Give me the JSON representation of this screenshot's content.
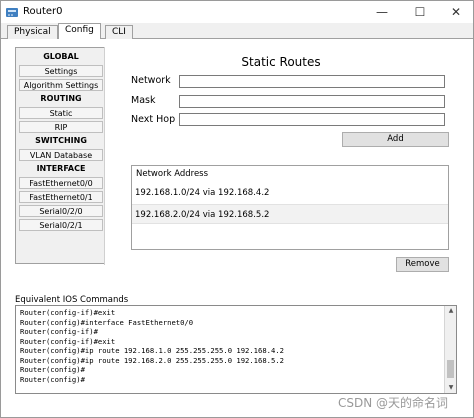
{
  "window": {
    "title": "Router0",
    "controls": {
      "minimize": "—",
      "maximize": "☐",
      "close": "✕"
    }
  },
  "tabs": [
    {
      "label": "Physical"
    },
    {
      "label": "Config"
    },
    {
      "label": "CLI"
    }
  ],
  "nav": {
    "global": "GLOBAL",
    "settings": "Settings",
    "algorithm_settings": "Algorithm Settings",
    "routing": "ROUTING",
    "static": "Static",
    "rip": "RIP",
    "switching": "SWITCHING",
    "vlan_database": "VLAN Database",
    "interface": "INTERFACE",
    "fe00": "FastEthernet0/0",
    "fe01": "FastEthernet0/1",
    "s020": "Serial0/2/0",
    "s021": "Serial0/2/1"
  },
  "static_routes": {
    "title": "Static Routes",
    "network_label": "Network",
    "mask_label": "Mask",
    "nexthop_label": "Next Hop",
    "network_value": "",
    "mask_value": "",
    "nexthop_value": "",
    "add_label": "Add",
    "table_header": "Network Address",
    "routes": [
      "192.168.1.0/24 via 192.168.4.2",
      "192.168.2.0/24 via 192.168.5.2"
    ],
    "remove_label": "Remove"
  },
  "ios": {
    "label": "Equivalent IOS Commands",
    "lines": [
      "Router(config-if)#exit",
      "Router(config)#interface FastEthernet0/0",
      "Router(config-if)#",
      "Router(config-if)#exit",
      "Router(config)#ip route 192.168.1.0 255.255.255.0 192.168.4.2",
      "Router(config)#ip route 192.168.2.0 255.255.255.0 192.168.5.2",
      "Router(config)#",
      "Router(config)#"
    ]
  },
  "watermark": "CSDN @天的命名词"
}
